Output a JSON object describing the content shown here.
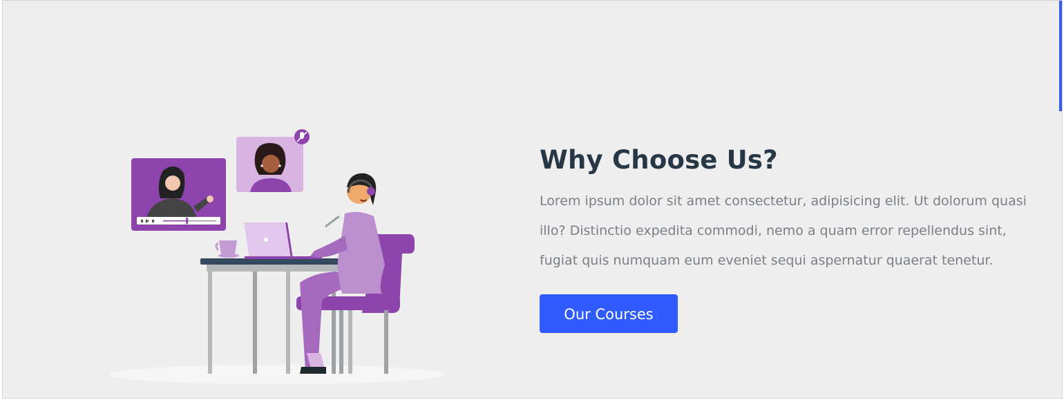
{
  "section": {
    "title": "Why Choose Us?",
    "description": "Lorem ipsum dolor sit amet consectetur, adipisicing elit. Ut dolorum quasi illo? Distinctio expedita commodi, nemo a quam error repellendus sint, fugiat quis numquam eum eveniet sequi aspernatur quaerat tenetur.",
    "button_label": "Our Courses"
  },
  "colors": {
    "accent": "#2f5bff",
    "purple": "#8e44ad",
    "background": "#eeeeee",
    "heading": "#273746",
    "text": "#7a7f86"
  },
  "illustration": {
    "icon": "online-learning-illustration",
    "video_progress": 0.45
  }
}
